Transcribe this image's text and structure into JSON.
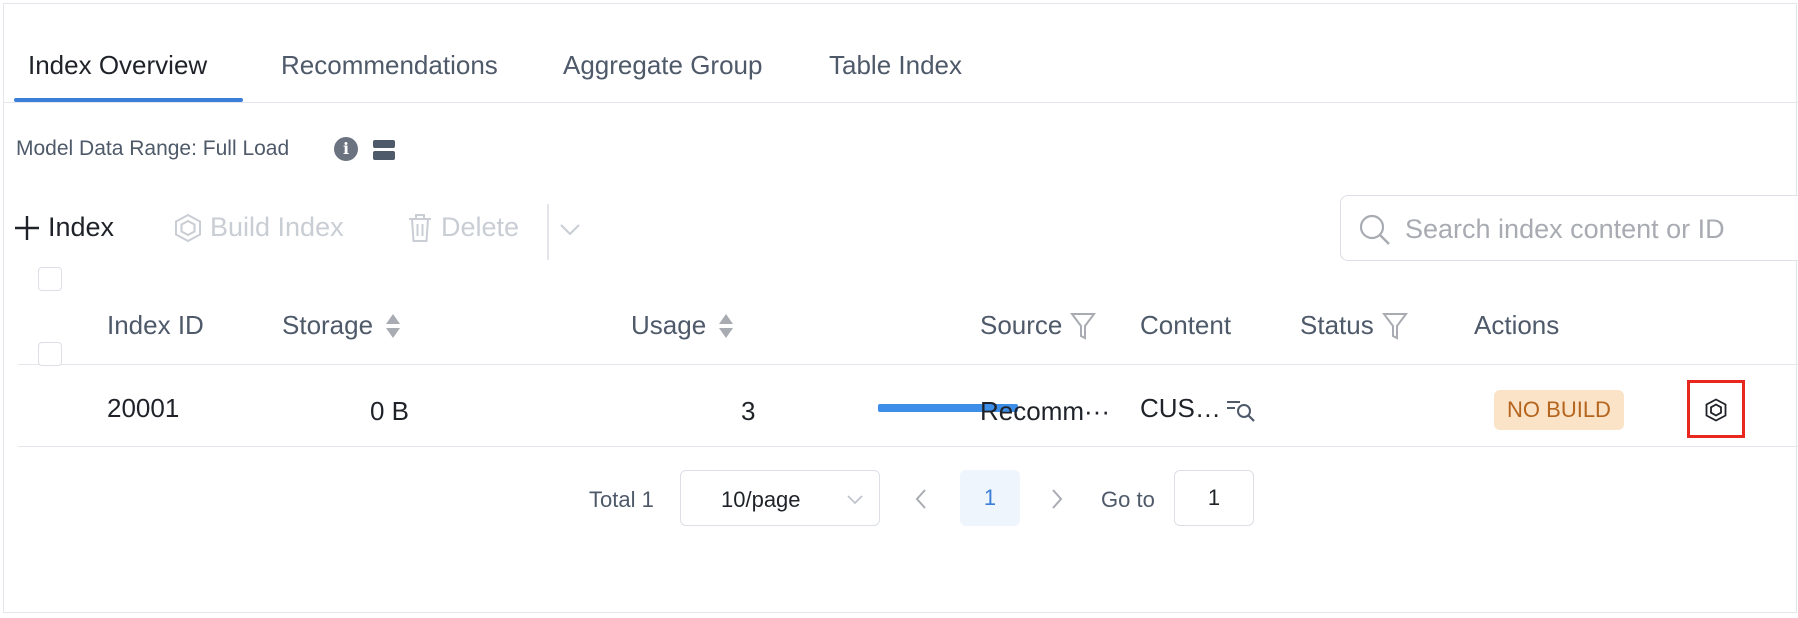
{
  "tabs": [
    {
      "label": "Index Overview",
      "active": true
    },
    {
      "label": "Recommendations",
      "active": false
    },
    {
      "label": "Aggregate Group",
      "active": false
    },
    {
      "label": "Table Index",
      "active": false
    }
  ],
  "data_range": {
    "label": "Model Data Range: Full Load",
    "icons": [
      "info-icon",
      "storage-icon"
    ]
  },
  "toolbar": {
    "add_label": "Index",
    "build_label": "Build Index",
    "delete_label": "Delete",
    "search_placeholder": "Search index content or ID"
  },
  "table": {
    "columns": [
      "Index ID",
      "Storage",
      "Usage",
      "Source",
      "Content",
      "Status",
      "Actions"
    ],
    "rows": [
      {
        "index_id": "20001",
        "storage": "0 B",
        "usage": "3",
        "source": "Recomm···",
        "content": "CUS…",
        "status": "NO BUILD"
      }
    ]
  },
  "pagination": {
    "total": "Total 1",
    "page_size": "10/page",
    "current_page": "1",
    "goto_label": "Go to",
    "goto_value": "1"
  },
  "colors": {
    "accent": "#3b7ed8",
    "usage_bar": "#3d8ee8",
    "status_badge_bg": "#fbe3c8",
    "status_badge_text": "#b5651d",
    "highlight_border": "#e8271f"
  }
}
